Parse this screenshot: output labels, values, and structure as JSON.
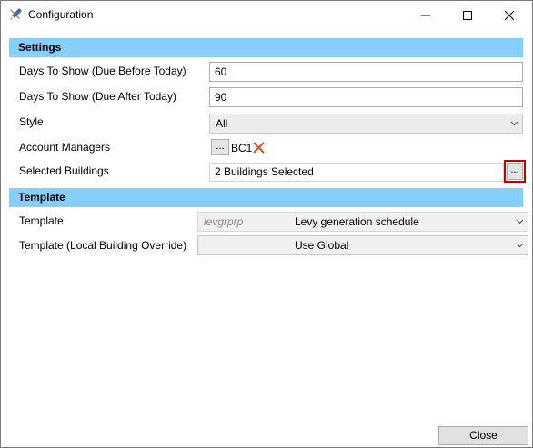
{
  "window": {
    "title": "Configuration",
    "icon": "tools-icon"
  },
  "settings": {
    "header": "Settings",
    "days_before": {
      "label": "Days To Show (Due Before Today)",
      "value": "60"
    },
    "days_after": {
      "label": "Days To Show (Due After Today)",
      "value": "90"
    },
    "style": {
      "label": "Style",
      "value": "All"
    },
    "account_managers": {
      "label": "Account Managers",
      "button": "...",
      "value": "BC1"
    },
    "selected_buildings": {
      "label": "Selected Buildings",
      "value": "2 Buildings Selected",
      "button": "..."
    }
  },
  "template": {
    "header": "Template",
    "template": {
      "label": "Template",
      "code": "levgrprp",
      "value": "Levy generation schedule"
    },
    "override": {
      "label": "Template (Local Building Override)",
      "value": "Use Global"
    }
  },
  "footer": {
    "close_label": "Close"
  },
  "colors": {
    "section_header": "#87cefa",
    "highlight_border": "#c00000",
    "remove_x": "#e05020"
  }
}
